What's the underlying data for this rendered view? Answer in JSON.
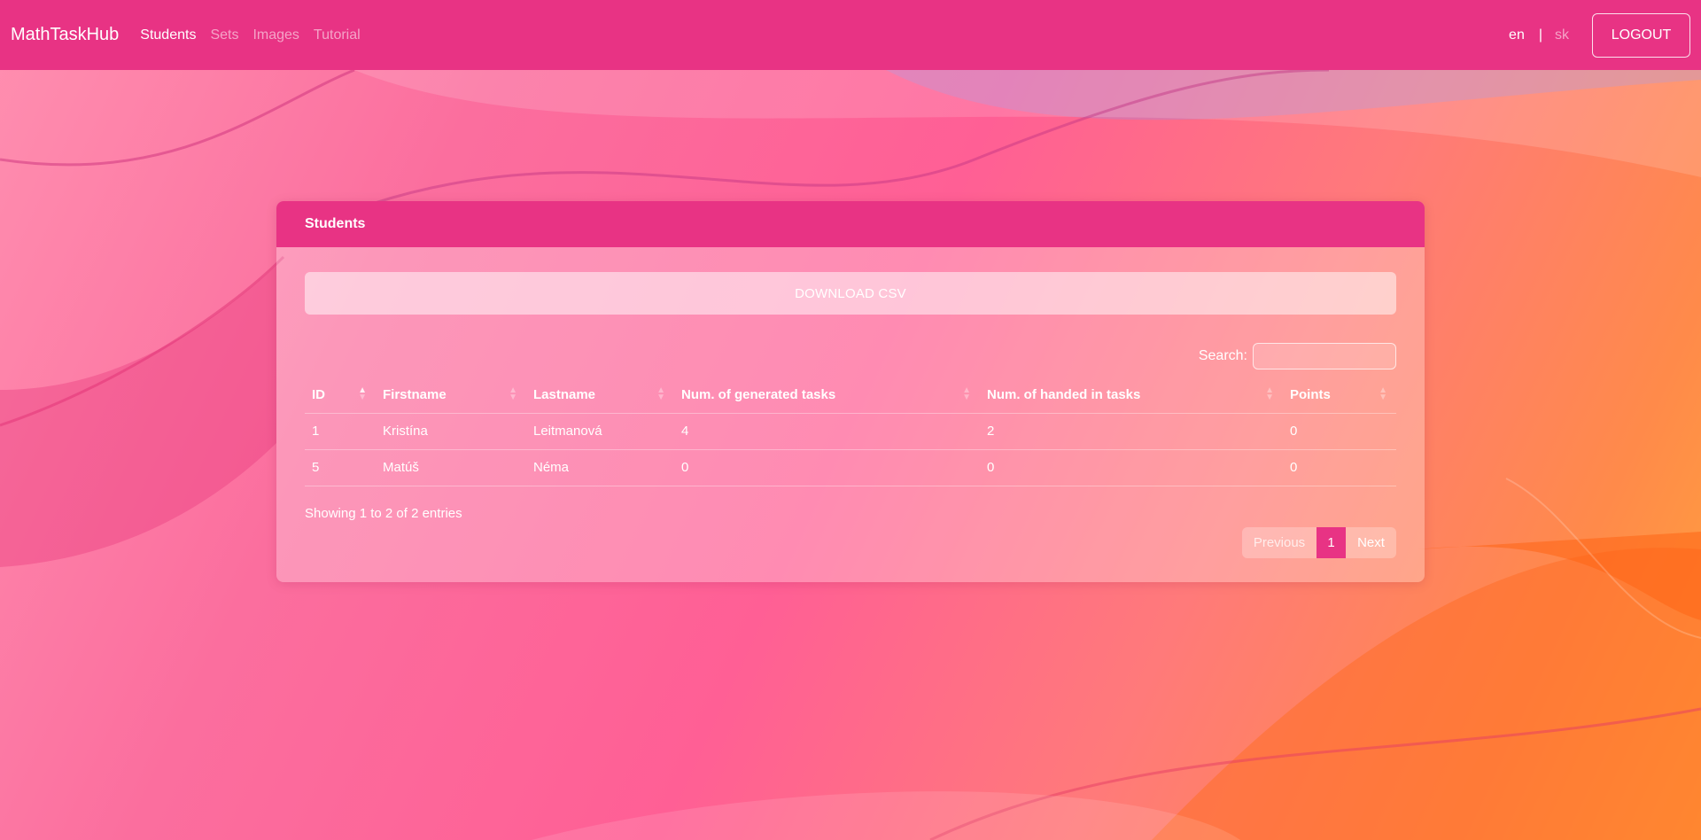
{
  "navbar": {
    "brand": "MathTaskHub",
    "links": [
      {
        "label": "Students",
        "active": true
      },
      {
        "label": "Sets",
        "active": false
      },
      {
        "label": "Images",
        "active": false
      },
      {
        "label": "Tutorial",
        "active": false
      }
    ],
    "lang_en": "en",
    "lang_sep": "|",
    "lang_sk": "sk",
    "logout_label": "LOGOUT"
  },
  "card": {
    "title": "Students",
    "download_label": "DOWNLOAD CSV",
    "search_label": "Search:",
    "search_value": ""
  },
  "table": {
    "columns": [
      "ID",
      "Firstname",
      "Lastname",
      "Num. of generated tasks",
      "Num. of handed in tasks",
      "Points"
    ],
    "rows": [
      [
        "1",
        "Kristína",
        "Leitmanová",
        "4",
        "2",
        "0"
      ],
      [
        "5",
        "Matúš",
        "Néma",
        "0",
        "0",
        "0"
      ]
    ]
  },
  "footer": {
    "info": "Showing 1 to 2 of 2 entries",
    "prev_label": "Previous",
    "page_label": "1",
    "next_label": "Next"
  },
  "colors": {
    "accent": "#e83384",
    "bg_gradient_start": "#ff8fb0",
    "bg_gradient_end": "#ffa53a"
  }
}
